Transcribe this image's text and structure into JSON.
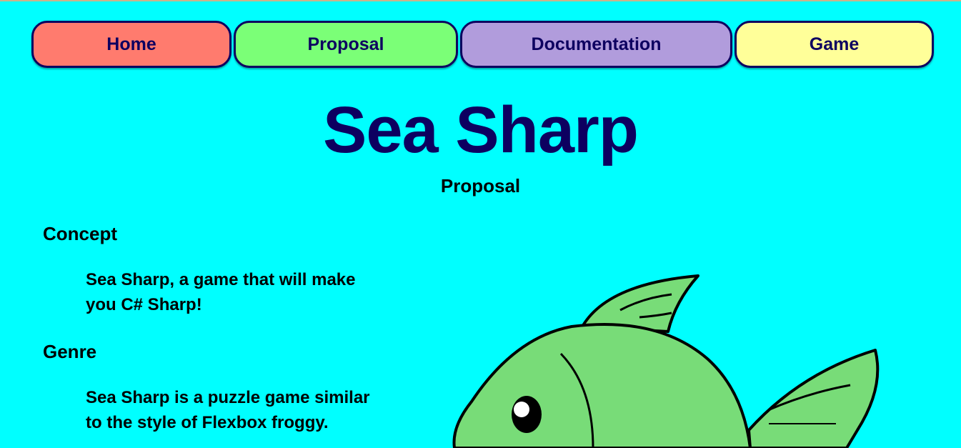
{
  "nav": [
    {
      "label": "Home",
      "color": "#ff7b6e"
    },
    {
      "label": "Proposal",
      "color": "#7bff77"
    },
    {
      "label": "Documentation",
      "color": "#b19cdc"
    },
    {
      "label": "Game",
      "color": "#ffff99"
    }
  ],
  "header": {
    "title": "Sea Sharp",
    "subtitle": "Proposal"
  },
  "sections": [
    {
      "heading": "Concept",
      "text": "Sea Sharp, a game that will make you C# Sharp!"
    },
    {
      "heading": "Genre",
      "text": "Sea Sharp is a puzzle game similar to the style of Flexbox froggy."
    }
  ],
  "image": {
    "icon": "fish-illustration",
    "fish_color": "#78dc78"
  }
}
